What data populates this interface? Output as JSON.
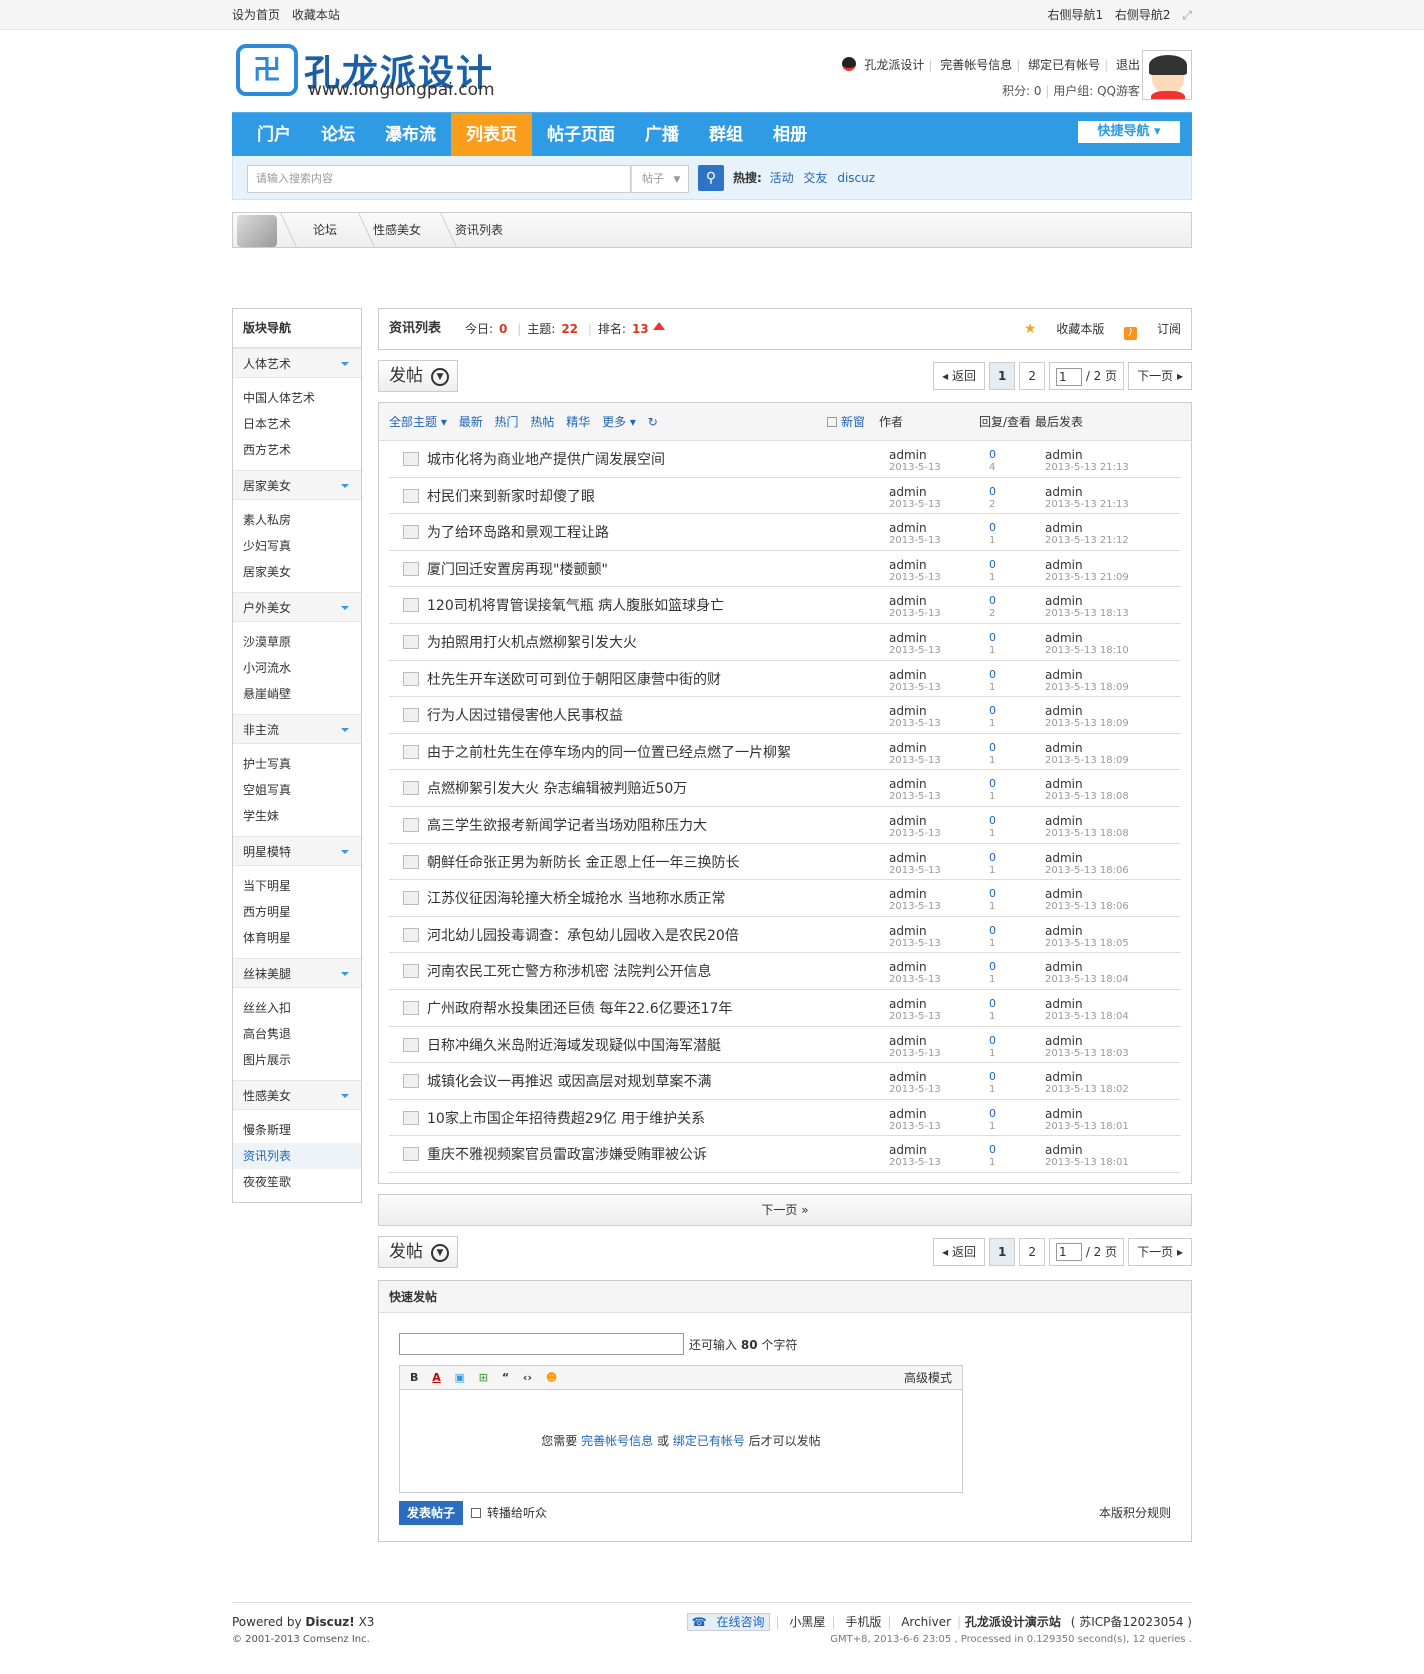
{
  "topbar": {
    "left": [
      "设为首页",
      "收藏本站"
    ],
    "right": [
      "右侧导航1",
      "右侧导航2"
    ]
  },
  "logo": {
    "mark": "卍",
    "cn": "孔龙派设计",
    "en": "www.longlongpai.com"
  },
  "user": {
    "name": "孔龙派设计",
    "links": [
      "完善帐号信息",
      "绑定已有帐号",
      "退出"
    ],
    "score": "积分: 0",
    "group": "用户组: QQ游客"
  },
  "nav": {
    "items": [
      "门户",
      "论坛",
      "瀑布流",
      "列表页",
      "帖子页面",
      "广播",
      "群组",
      "相册"
    ],
    "active": 3,
    "quick": "快捷导航"
  },
  "search": {
    "placeholder": "请输入搜索内容",
    "select": "帖子",
    "hot_label": "热搜:",
    "hot": [
      "活动",
      "交友",
      "discuz"
    ]
  },
  "crumb": [
    "论坛",
    "性感美女",
    "资讯列表"
  ],
  "side": {
    "title": "版块导航",
    "groups": [
      {
        "name": "人体艺术",
        "items": [
          "中国人体艺术",
          "日本艺术",
          "西方艺术"
        ]
      },
      {
        "name": "居家美女",
        "items": [
          "素人私房",
          "少妇写真",
          "居家美女"
        ]
      },
      {
        "name": "户外美女",
        "items": [
          "沙漠草原",
          "小河流水",
          "悬崖峭壁"
        ]
      },
      {
        "name": "非主流",
        "items": [
          "护士写真",
          "空姐写真",
          "学生妹"
        ]
      },
      {
        "name": "明星模特",
        "items": [
          "当下明星",
          "西方明星",
          "体育明星"
        ]
      },
      {
        "name": "丝袜美腿",
        "items": [
          "丝丝入扣",
          "高台隽退",
          "图片展示"
        ]
      },
      {
        "name": "性感美女",
        "items": [
          "慢条斯理",
          "资讯列表",
          "夜夜笙歌"
        ]
      }
    ]
  },
  "forum": {
    "title": "资讯列表",
    "today_label": "今日:",
    "today": "0",
    "topics_label": "主题:",
    "topics": "22",
    "rank_label": "排名:",
    "rank": "13",
    "fav": "收藏本版",
    "rss": "订阅"
  },
  "pager": {
    "post": "发帖",
    "back": "返回",
    "p1": "1",
    "p2": "2",
    "input": "1",
    "total": "/ 2 页",
    "next": "下一页"
  },
  "filter": {
    "items": [
      "全部主题",
      "最新",
      "热门",
      "热帖",
      "精华",
      "更多"
    ],
    "new": "新窗",
    "author": "作者",
    "reply": "回复/查看",
    "last": "最后发表"
  },
  "threads": [
    {
      "t": "城市化将为商业地产提供广阔发展空间",
      "r": "0",
      "v": "4",
      "lt": "2013-5-13 21:13"
    },
    {
      "t": "村民们来到新家时却傻了眼",
      "r": "0",
      "v": "2",
      "lt": "2013-5-13 21:13"
    },
    {
      "t": "为了给环岛路和景观工程让路",
      "r": "0",
      "v": "1",
      "lt": "2013-5-13 21:12"
    },
    {
      "t": "厦门回迁安置房再现\"楼颤颤\"",
      "r": "0",
      "v": "1",
      "lt": "2013-5-13 21:09"
    },
    {
      "t": "120司机将胃管误接氧气瓶 病人腹胀如篮球身亡",
      "r": "0",
      "v": "2",
      "lt": "2013-5-13 18:13"
    },
    {
      "t": "为拍照用打火机点燃柳絮引发大火",
      "r": "0",
      "v": "1",
      "lt": "2013-5-13 18:10"
    },
    {
      "t": "杜先生开车送欧可可到位于朝阳区康营中街的财",
      "r": "0",
      "v": "1",
      "lt": "2013-5-13 18:09"
    },
    {
      "t": "行为人因过错侵害他人民事权益",
      "r": "0",
      "v": "1",
      "lt": "2013-5-13 18:09"
    },
    {
      "t": "由于之前杜先生在停车场内的同一位置已经点燃了一片柳絮",
      "r": "0",
      "v": "1",
      "lt": "2013-5-13 18:09"
    },
    {
      "t": "点燃柳絮引发大火 杂志编辑被判赔近50万",
      "r": "0",
      "v": "1",
      "lt": "2013-5-13 18:08"
    },
    {
      "t": "高三学生欲报考新闻学记者当场劝阻称压力大",
      "r": "0",
      "v": "1",
      "lt": "2013-5-13 18:08"
    },
    {
      "t": "朝鲜任命张正男为新防长 金正恩上任一年三换防长",
      "r": "0",
      "v": "1",
      "lt": "2013-5-13 18:06"
    },
    {
      "t": "江苏仪征因海轮撞大桥全城抢水 当地称水质正常",
      "r": "0",
      "v": "1",
      "lt": "2013-5-13 18:06"
    },
    {
      "t": "河北幼儿园投毒调查：承包幼儿园收入是农民20倍",
      "r": "0",
      "v": "1",
      "lt": "2013-5-13 18:05"
    },
    {
      "t": "河南农民工死亡警方称涉机密 法院判公开信息",
      "r": "0",
      "v": "1",
      "lt": "2013-5-13 18:04"
    },
    {
      "t": "广州政府帮水投集团还巨债 每年22.6亿要还17年",
      "r": "0",
      "v": "1",
      "lt": "2013-5-13 18:04"
    },
    {
      "t": "日称冲绳久米岛附近海域发现疑似中国海军潜艇",
      "r": "0",
      "v": "1",
      "lt": "2013-5-13 18:03"
    },
    {
      "t": "城镇化会议一再推迟 或因高层对规划草案不满",
      "r": "0",
      "v": "1",
      "lt": "2013-5-13 18:02"
    },
    {
      "t": "10家上市国企年招待费超29亿 用于维护关系",
      "r": "0",
      "v": "1",
      "lt": "2013-5-13 18:01"
    },
    {
      "t": "重庆不雅视频案官员雷政富涉嫌受贿罪被公诉",
      "r": "0",
      "v": "1",
      "lt": "2013-5-13 18:01"
    }
  ],
  "thread_author": "admin",
  "thread_date": "2013-5-13",
  "nextpage": "下一页 »",
  "fast": {
    "title": "快速发帖",
    "tip_a": "还可输入",
    "tip_n": "80",
    "tip_b": "个字符",
    "adv": "高级模式",
    "msg_a": "您需要",
    "link1": "完善帐号信息",
    "msg_b": "或",
    "link2": "绑定已有帐号",
    "msg_c": "后才可以发帖",
    "submit": "发表帖子",
    "chk": "转播给听众",
    "rule": "本版积分规则"
  },
  "footer": {
    "powered": "Powered by",
    "brand": "Discuz!",
    "ver": "X3",
    "copy": "© 2001-2013 Comsenz Inc.",
    "links": [
      "在线咨询",
      "小黑屋",
      "手机版",
      "Archiver"
    ],
    "site": "孔龙派设计演示站",
    "icp": "( 苏ICP备12023054 )",
    "gmt": "GMT+8, 2013-6-6 23:05 , Processed in 0.129350 second(s), 12 queries ."
  }
}
